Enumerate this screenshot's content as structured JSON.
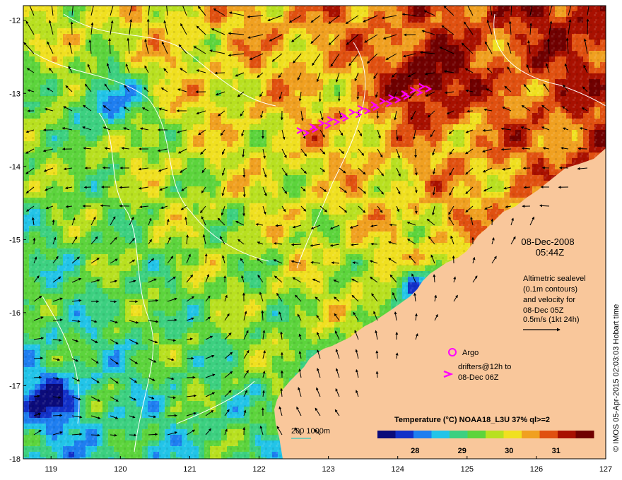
{
  "map": {
    "lon_ticks": [
      "119",
      "120",
      "121",
      "122",
      "123",
      "124",
      "125",
      "126",
      "127"
    ],
    "lat_ticks": [
      "-12",
      "-13",
      "-14",
      "-15",
      "-16",
      "-17",
      "-18"
    ],
    "lon_range": [
      118.6,
      127.0
    ],
    "lat_range": [
      -18.0,
      -11.8
    ],
    "colors": {
      "land": "#f9c79b",
      "drifter": "#ff00ff",
      "contour": "#ffffff",
      "scale_bar": "#00c8c8"
    }
  },
  "info": {
    "date": "08-Dec-2008",
    "time": "05:44Z",
    "altimetry_lines": [
      "Altimetric sealevel",
      "(0.1m contours)",
      "and velocity for",
      "08-Dec 05Z"
    ],
    "velocity_scale": "0.5m/s (1kt 24h)",
    "argo_label": "Argo",
    "drifters_lines": [
      "drifters@12h to",
      "08-Dec 06Z"
    ]
  },
  "scale_bar": {
    "label": "200  1000m"
  },
  "colorbar": {
    "title": "Temperature (°C) NOAA18_L3U 37% ql>=2",
    "ticks": [
      "28",
      "29",
      "30",
      "31"
    ],
    "range": [
      27.2,
      31.8
    ],
    "colors": [
      "#0b0b7a",
      "#1230c8",
      "#1e7ef0",
      "#22c4e8",
      "#3cd080",
      "#5cd43c",
      "#b8e020",
      "#f0e020",
      "#f0a020",
      "#e05010",
      "#a81000",
      "#700000"
    ]
  },
  "credit": "© IMOS 05-Apr-2015 02:03:03 Hobart time"
}
